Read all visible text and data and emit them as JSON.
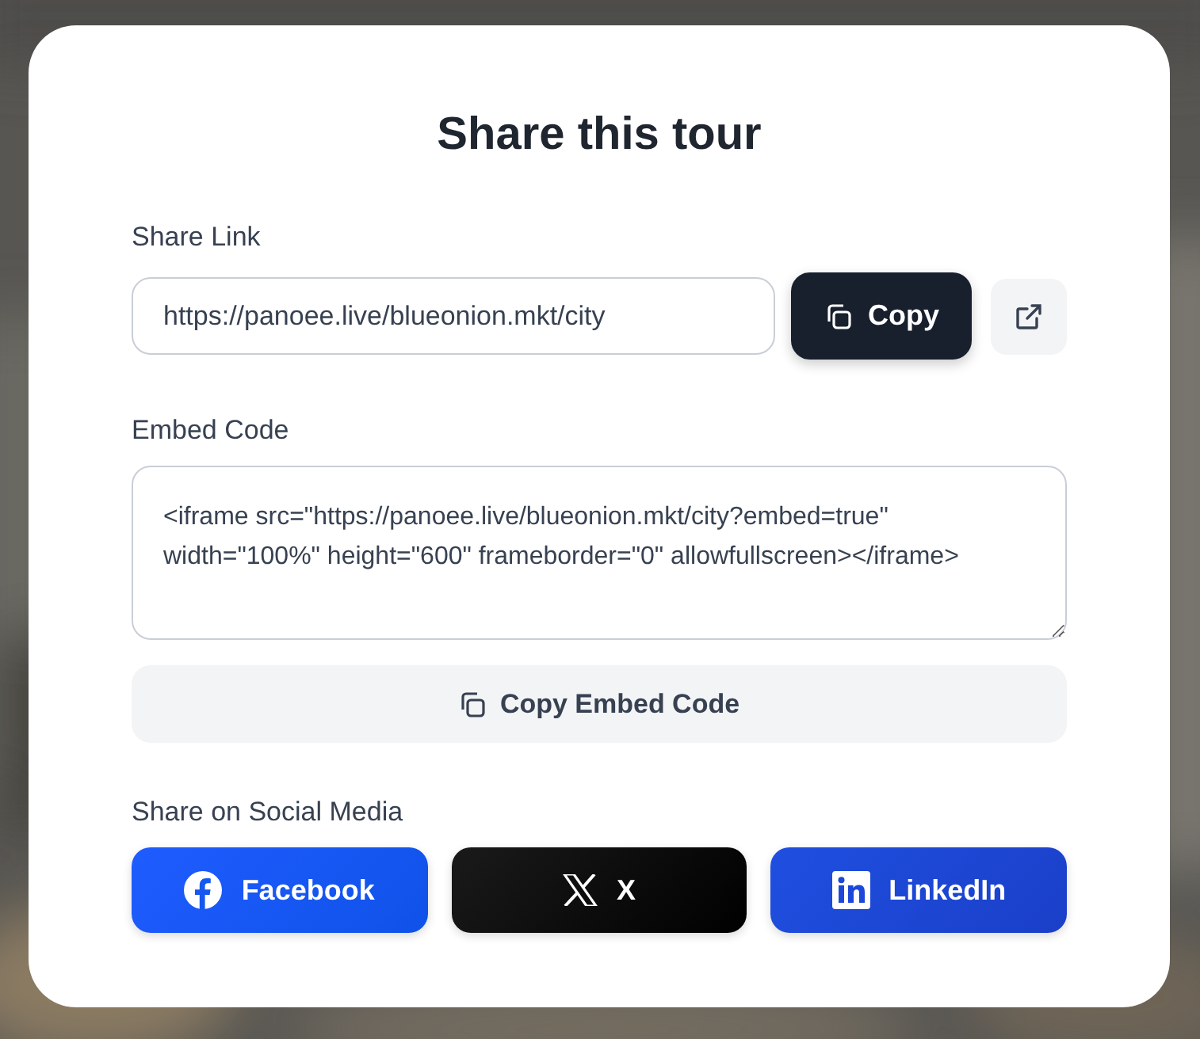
{
  "dialog": {
    "title": "Share this tour"
  },
  "share_link": {
    "label": "Share Link",
    "value": "https://panoee.live/blueonion.mkt/city",
    "copy_button": "Copy"
  },
  "embed_code": {
    "label": "Embed Code",
    "value": "<iframe src=\"https://panoee.live/blueonion.mkt/city?embed=true\" width=\"100%\" height=\"600\" frameborder=\"0\" allowfullscreen></iframe>",
    "copy_button": "Copy Embed Code"
  },
  "social": {
    "label": "Share on Social Media",
    "buttons": [
      {
        "kind": "facebook",
        "label": "Facebook"
      },
      {
        "kind": "x",
        "label": "X"
      },
      {
        "kind": "linkedin",
        "label": "LinkedIn"
      }
    ]
  }
}
